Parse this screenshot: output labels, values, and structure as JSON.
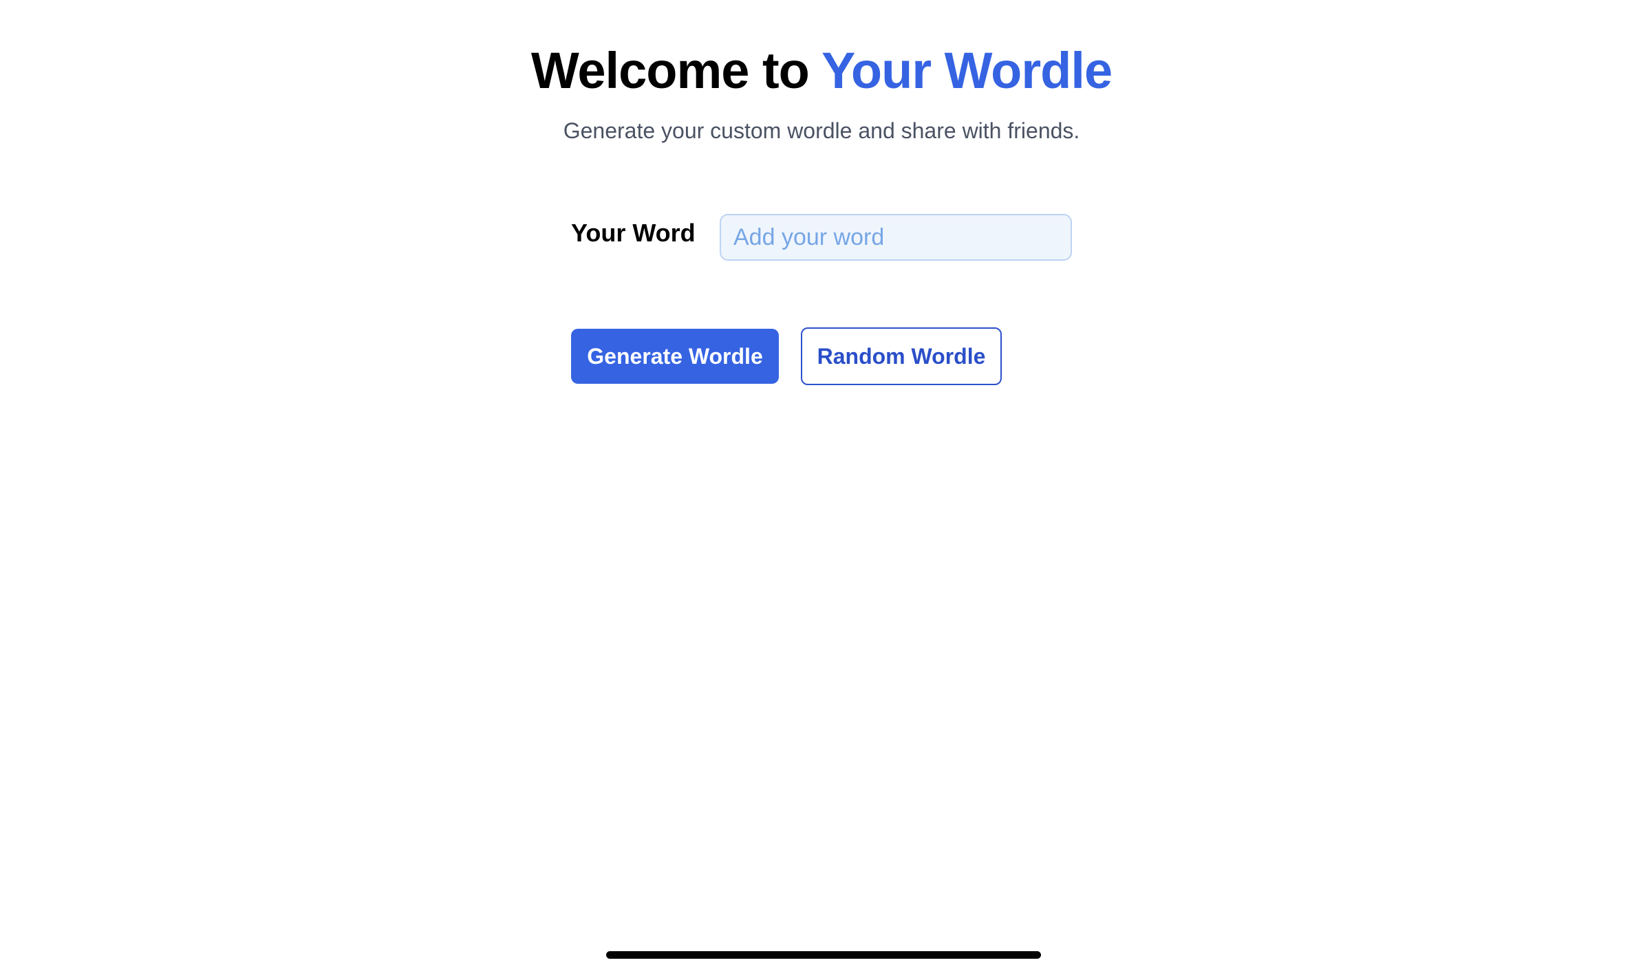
{
  "header": {
    "title_prefix": "Welcome to ",
    "title_highlight": "Your Wordle",
    "subtitle": "Generate your custom wordle and share with friends."
  },
  "form": {
    "word_label": "Your Word",
    "word_input_value": "",
    "word_input_placeholder": "Add your word"
  },
  "actions": {
    "generate_label": "Generate Wordle",
    "random_label": "Random Wordle"
  },
  "colors": {
    "accent": "#3563e2",
    "subtitle_text": "#4a5263",
    "input_background": "#eff5fc",
    "input_border": "#bcd3f3",
    "placeholder_text": "#76a6e6",
    "secondary_button_text": "#2b4fc9"
  }
}
